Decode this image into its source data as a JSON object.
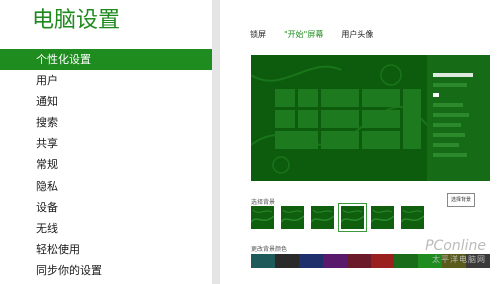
{
  "app": {
    "title": "电脑设置"
  },
  "menu": [
    {
      "label": "个性化设置",
      "active": true
    },
    {
      "label": "用户"
    },
    {
      "label": "通知"
    },
    {
      "label": "搜索"
    },
    {
      "label": "共享"
    },
    {
      "label": "常规"
    },
    {
      "label": "隐私"
    },
    {
      "label": "设备"
    },
    {
      "label": "无线"
    },
    {
      "label": "轻松使用"
    },
    {
      "label": "同步你的设置"
    }
  ],
  "tabs": [
    {
      "label": "锁屏"
    },
    {
      "label": "\"开始\"屏幕",
      "active": true
    },
    {
      "label": "用户头像"
    }
  ],
  "background": {
    "label": "选择背景",
    "button_label": "选择背景",
    "thumb_count": 6,
    "selected_index": 3
  },
  "color": {
    "label": "更改背景颜色",
    "swatches": [
      "#1f5a5a",
      "#2a2a2a",
      "#1f2f6b",
      "#5a1a6b",
      "#6b1a2a",
      "#9a1f1f",
      "#1a6b1a",
      "#1f8c1f",
      "#5a5a1a",
      "#3a3a3a"
    ]
  },
  "watermark": {
    "line1": "PConline",
    "line2": "太平洋电脑网"
  },
  "colors": {
    "accent": "#1f8c1f",
    "preview_bg": "#0d5c0d"
  }
}
